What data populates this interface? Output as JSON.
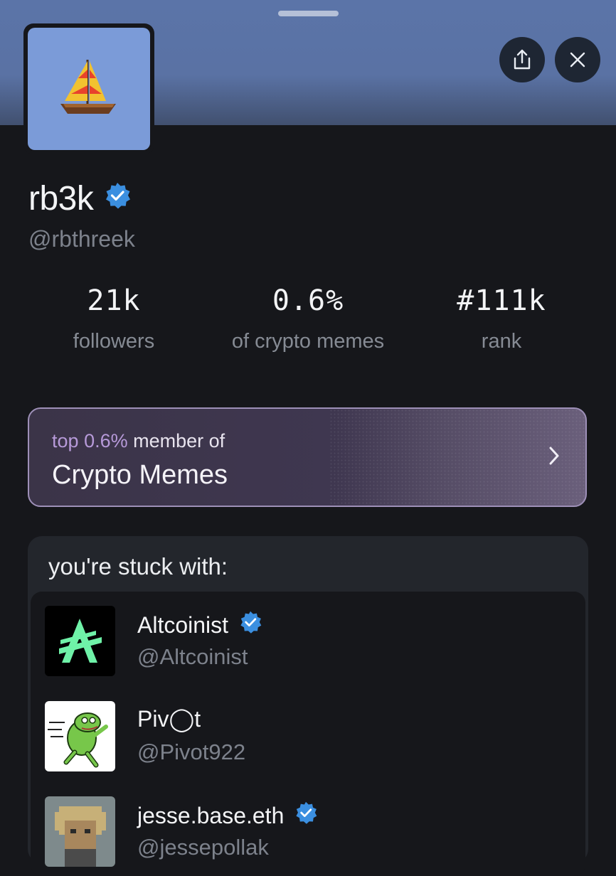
{
  "colors": {
    "header_top": "#5b74a8",
    "background": "#16171b",
    "accent_verified": "#3b8fe0",
    "community_highlight": "#b79ad9",
    "muted_text": "#7d828c"
  },
  "header": {
    "share_icon": "share-icon",
    "close_icon": "close-icon"
  },
  "profile": {
    "avatar_icon": "sailboat-icon",
    "display_name": "rb3k",
    "handle": "@rbthreek",
    "verified_icon": "verified-badge-icon"
  },
  "stats": [
    {
      "value": "21k",
      "label": "followers"
    },
    {
      "value": "0.6%",
      "label": "of crypto memes"
    },
    {
      "value": "#111k",
      "label": "rank"
    }
  ],
  "community": {
    "prefix": "top",
    "percent": "0.6%",
    "suffix": "member of",
    "title": "Crypto Memes",
    "chevron_icon": "chevron-right-icon"
  },
  "stuck_with": {
    "title": "you're stuck with:",
    "accounts": [
      {
        "name": "Altcoinist",
        "handle": "@Altcoinist",
        "verified": true,
        "avatar": "altcoinist-logo-icon"
      },
      {
        "name": "Piv◯t",
        "handle": "@Pivot922",
        "verified": false,
        "avatar": "pepe-frog-icon"
      },
      {
        "name": "jesse.base.eth",
        "handle": "@jessepollak",
        "verified": true,
        "avatar": "pixel-portrait-icon"
      }
    ]
  }
}
